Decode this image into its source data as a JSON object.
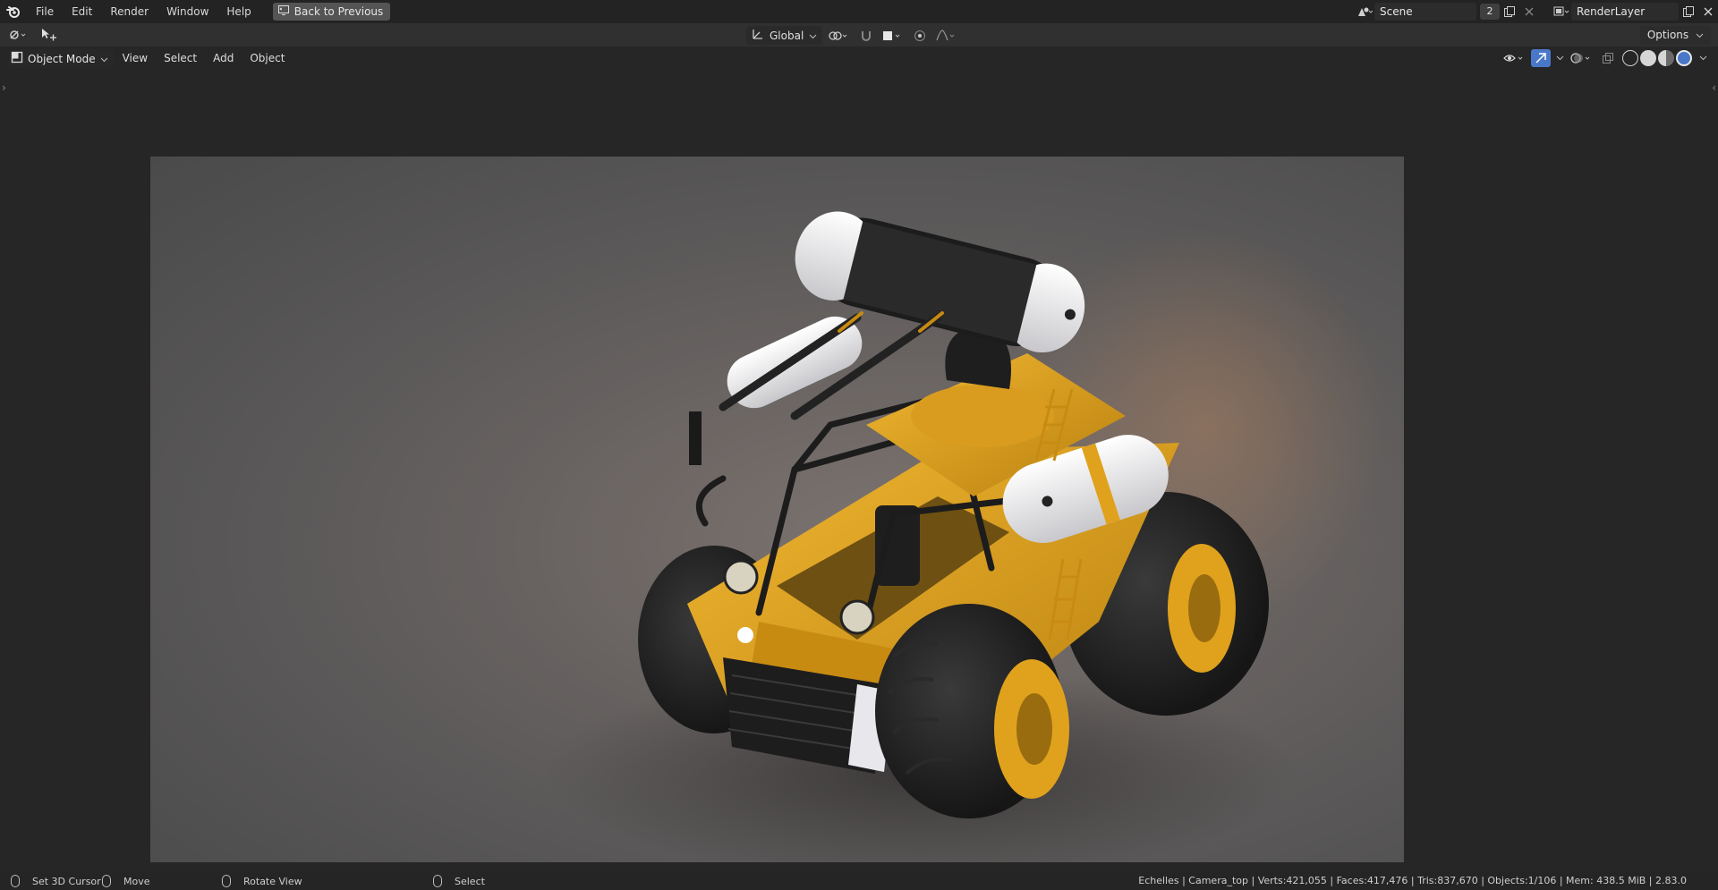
{
  "menubar": {
    "items": [
      "File",
      "Edit",
      "Render",
      "Window",
      "Help"
    ],
    "back_button": "Back to Previous"
  },
  "scene": {
    "name": "Scene",
    "users": "2"
  },
  "render_layer": {
    "name": "RenderLayer"
  },
  "toolbar": {
    "orientation": "Global",
    "options_label": "Options"
  },
  "viewport_header": {
    "mode": "Object Mode",
    "menus": [
      "View",
      "Select",
      "Add",
      "Object"
    ]
  },
  "statusbar": {
    "hints": [
      {
        "label": "Set 3D Cursor"
      },
      {
        "label": "Move"
      },
      {
        "label": "Rotate View"
      },
      {
        "label": "Select"
      }
    ],
    "stats": "Echelles | Camera_top | Verts:421,055 | Faces:417,476 | Tris:837,670 | Objects:1/106 | Mem: 438.5 MiB | 2.83.0"
  },
  "colors": {
    "vehicle_body": "#e0a21c",
    "accent_active": "#4a78c8"
  }
}
